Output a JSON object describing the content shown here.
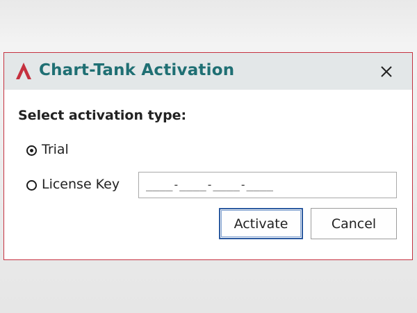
{
  "dialog": {
    "title": "Chart-Tank Activation",
    "logo_icon": "chart-tank-a-logo",
    "close_icon": "close-x-icon",
    "prompt": "Select activation type:",
    "options": [
      {
        "label": "Trial",
        "selected": true
      },
      {
        "label": "License Key",
        "selected": false
      }
    ],
    "license_key_value": "____-____-____-____",
    "activate_label": "Activate",
    "cancel_label": "Cancel"
  },
  "colors": {
    "accent_red": "#c5313f",
    "title_teal": "#1f6f73",
    "titlebar_bg": "#e3e7e8",
    "default_button_border": "#2c5aa0"
  }
}
